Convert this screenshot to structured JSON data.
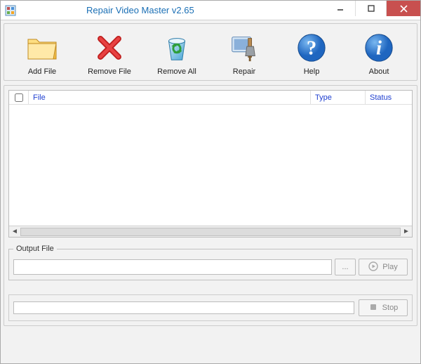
{
  "window": {
    "title": "Repair Video Master v2.65"
  },
  "toolbar": {
    "items": [
      {
        "label": "Add File",
        "icon": "folder-add-icon"
      },
      {
        "label": "Remove File",
        "icon": "x-red-icon"
      },
      {
        "label": "Remove All",
        "icon": "trash-icon"
      },
      {
        "label": "Repair",
        "icon": "repair-tools-icon"
      },
      {
        "label": "Help",
        "icon": "question-icon"
      },
      {
        "label": "About",
        "icon": "info-icon"
      }
    ]
  },
  "list": {
    "columns": {
      "file": "File",
      "type": "Type",
      "status": "Status"
    },
    "rows": []
  },
  "output": {
    "legend": "Output File",
    "path": "",
    "browse_label": "...",
    "play_label": "Play"
  },
  "progress": {
    "stop_label": "Stop"
  }
}
